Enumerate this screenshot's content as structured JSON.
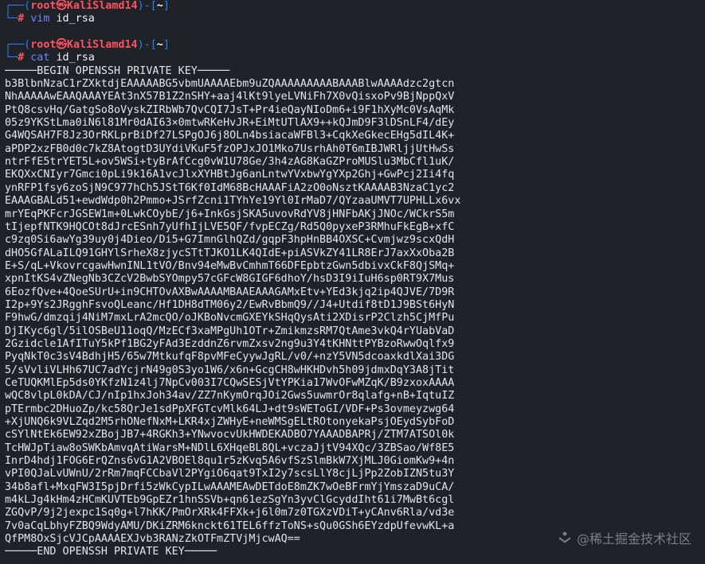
{
  "prompt1": {
    "corner_top": "┌──(",
    "user": "root㉿KaliSlamd14",
    "mid": ")-[",
    "path": "~",
    "close": "]",
    "corner_bottom": "└─",
    "hash": "#",
    "command": "vim",
    "argument": "id_rsa"
  },
  "prompt2": {
    "corner_top": "┌──(",
    "user": "root㉿KaliSlamd14",
    "mid": ")-[",
    "path": "~",
    "close": "]",
    "corner_bottom": "└─",
    "hash": "#",
    "command": "cat",
    "argument": "id_rsa"
  },
  "key_header": "─────BEGIN OPENSSH PRIVATE KEY─────",
  "key_footer": "─────END OPENSSH PRIVATE KEY─────",
  "key_lines": [
    "b3BlbnNzaC1rZXktdjEAAAAABG5vbmUAAAAEbm9uZQAAAAAAAAABAAABlwAAAAdzc2gtcn",
    "NhAAAAAwEAAQAAAYEAt3nX57B1Z2nSHY+aaj4lKt9lyeLVNiFh7X0vQisxoPv9BjNppQxV",
    "PtQ8csvHq/GatgSo8oVyskZIRbWb7QvCQI7JsT+Pr4ieQayNIoDm6+i9F1hXyMc0VsAqMk",
    "05z9YKStLma0iN6l81Mr0dAI63×0mtwRKeHvJR+EiMtUTlAX9++kQJmD9F3lDSnLF4/dEy",
    "G4WQSAH7F8Jz3OrRKLprBiDf27LSPgOJ6j8OLn4bsiacaWFBl3+CqkXeGkecEHg5dIL4K+",
    "aPDP2xzFB0d0c7kZ8AtogtD3UYdiVKuF5fzOPJxJO1Mko7UsrhAh0T6mIBJWRljjUtHwSs",
    "ntrFfE5trYET5L+ov5WSi+tyBrAfCcg0vW1U78Ge/3h4zAG8KaGZProMUSlu3MbCfl1uK/",
    "EKQXxCNIyr7Gmci0pLi9k16A1vcJlxXYHBtJg6anLntwYVxbwYgYXp2Ghj+GwPcj2Ii4fq",
    "ynRFP1fsy6zoSjN9C977hCh5JStT6Kf0IdM68BcHAAAFiA2zO0oNsztKAAAAB3NzaC1yc2",
    "EAAAGBALd51+ewdWdp0h2Pmmo+JSrfZcni1TYhYe19Yl0IrMaD7/QYzaaUMVT7UPHLLx6vx",
    "mrYEqPKFcrJGSEW1m+0LwkCOybE/j6+InkGsjSKA5uvovRdYV8jHNFbAKjJNOc/WCkrS5m",
    "tIjepfNTK9HQCOt8dJrcESnh7yUfhIjLVE5QF/fvpECZg/Rd5Q0pyxeP3RMhuFkEgB+xfC",
    "c9zq0Si6awYg39uy0j4Dieo/Di5+G7ImnGlhQZd/gqpF3hpHnBB4OXSC+Cvmjwz9scxQdH",
    "dHO5GfALaILQ91GHYlSrheX8zjycSTtTJKO1LK4QIdE+piASVkZY41LR8ErJ7axXxOba2B",
    "E+S/qL+VkovrcgawHwnINL1tVO/Bnv94eMwBvCmhmT66DFEpbtzGwn5dbivxCkF8QjSMq+",
    "xpnItKS4vZNegNb3CZcV2BwbSYOmpy57cGFcW8GIGF6dhoY/hsD3I9iIuH6sp0RT9X7Mus",
    "6EozfQve+4QoeSUrU+in9CHTOvAXBwAAAAMBAAEAAAGAMxEtv+YEd3kjq2ip4QJVE/7D9R",
    "I2p+9Ys2JRgghFsvoQLeanc/Hf1DH8dTM06y2/EwRvBbmQ9//J4+Utdif8tD1J9BSt6HyN",
    "F9hwG/dmzqij4NiM7mxLrA2mcQO/oJKBoNvcmGXEYkSHqQysAti2XDisrP2Clzh5CjMfPu",
    "DjIKyc6gl/5ilOSBeU11oqQ/MzECf3xaMPgUh1OTr+ZmikmzsRM7QtAme3vkQ4rYUabVaD",
    "2Gzidcle1AfITuY5kPf1BG2yFAd3EzddnZ6rvmZxsv2ng9u3Y4tKHNttPYBzoRwwOqlfx9",
    "PyqNkT0c3sV4BdhjH5/65w7MtkufqF8pvMFeCyywJgRL/v0/+nzY5VN5dcoaxkdlXai3DG",
    "5/sVvliVLHh67UC7adYcjrN49g0S3yo1W6/x6n+GcgCH8wHKHDvh5h09jdmxDqY3A8jTit",
    "CeTUQKMlEp5ds0YKfzN1z4lj7NpCv003I7CQwSESjVtYPKia17WvOFwMZqK/B9zxoxAAAA",
    "wQC8vlpL0kDA/CJ/nIp1hxJoh34av/ZZ7nKymOrqJOi2Gws5uwmrOr8qlafg+nB+IqtuIZ",
    "pTErmbc2DHuoZp/kc58QrJe1sdPpXFGTcvMlk64LJ+dt9sWEToGI/VDF+Ps3ovmeyzwg64",
    "+XjUNQ6k9VLZqd2M5rhONefNxM+LKR4xjZWHyE+neWMSgELtROtonyekaPsjOEydSybFoD",
    "cSYlNtEk6EW92xZBojJB7+4RGKh3+YNwvocvUkHWDEKADBO7YAAADBAPRj/ZTM7ATSOl0k",
    "TcHWJpTiaw8oSWKbAmvqAtiWarsM+NDlL6XHqeBL8QL+vczaJjtV94XQc/3ZBSao/Wf8E5",
    "InrD4hdj1FOG6ErQZns6vG1A2VBOEl8qu1r5zKvq5A6vfSzSlmBkW7XjMLJ0GiomKw9+4n",
    "vPI0QJaLvUWnU/2rRm7mqFCCbaVl2PYgiO6qat9TxI2y7scsLlY8cjLjPp2ZobIZN5tu3Y",
    "34b8afl+MxqFW3I5pjDrfi5zWkCypILwAAAMEAwDETdoE8mZK7wOeBFrmYjYmszaD9uCA/",
    "m4kLJg4kHm4zHCmKUVTEb9GpEZr1hnSSVb+qn61ezSgYn3yvClGcyddIht61i7MwBt6cgl",
    "ZGQvP/9j2jexpc1Sq0g+l7hKK/PmOrXRk4FFXk+j6l0m7z0TGXzVDiT+yCAnv6Rla/vd3e",
    "7v0aCqLbhyFZBQ9WdyAMU/DKiZRM6knckt61TEL6ffzToNS+sQu0GSh6EYzdpUfevwKL+a",
    "QfPM8OxSjcVJCpAAAAEXJvb3RANzZkOTFmZTVjMjcwAQ=="
  ],
  "watermark": {
    "text": "@稀土掘金技术社区"
  }
}
